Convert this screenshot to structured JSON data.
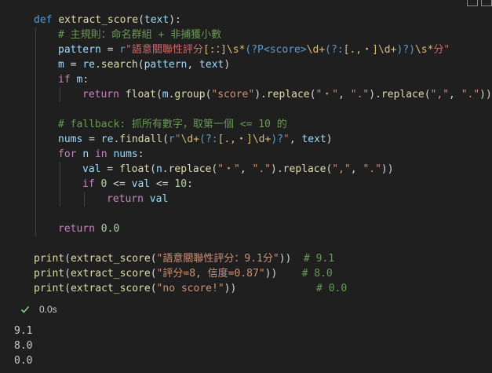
{
  "code": {
    "lines": [
      {
        "tokens": [
          {
            "t": "def",
            "k": "kw"
          },
          {
            "t": " ",
            "k": "op"
          },
          {
            "t": "extract_score",
            "k": "fn"
          },
          {
            "t": "(",
            "k": "op"
          },
          {
            "t": "text",
            "k": "var"
          },
          {
            "t": "):",
            "k": "op"
          }
        ]
      },
      {
        "tokens": [
          {
            "t": "# 主規則：命名群組 + 非捕獲小數",
            "k": "cmt"
          }
        ]
      },
      {
        "tokens": [
          {
            "t": "pattern",
            "k": "var"
          },
          {
            "t": " = ",
            "k": "op"
          },
          {
            "t": "r",
            "k": "kw"
          },
          {
            "t": "\"語意關聯性評分",
            "k": "re"
          },
          {
            "t": "[:：]",
            "k": "rech"
          },
          {
            "t": "\\s",
            "k": "rech"
          },
          {
            "t": "*",
            "k": "rech"
          },
          {
            "t": "(?P<score>",
            "k": "regrp"
          },
          {
            "t": "\\d",
            "k": "rech"
          },
          {
            "t": "+",
            "k": "rech"
          },
          {
            "t": "(?:",
            "k": "regrp"
          },
          {
            "t": "[.,・]",
            "k": "rech"
          },
          {
            "t": "\\d",
            "k": "rech"
          },
          {
            "t": "+",
            "k": "rech"
          },
          {
            "t": ")?",
            "k": "regrp"
          },
          {
            "t": ")",
            "k": "regrp"
          },
          {
            "t": "\\s",
            "k": "rech"
          },
          {
            "t": "*",
            "k": "rech"
          },
          {
            "t": "分\"",
            "k": "re"
          }
        ]
      },
      {
        "tokens": [
          {
            "t": "m",
            "k": "var"
          },
          {
            "t": " = ",
            "k": "op"
          },
          {
            "t": "re",
            "k": "var"
          },
          {
            "t": ".",
            "k": "op"
          },
          {
            "t": "search",
            "k": "fn"
          },
          {
            "t": "(",
            "k": "op"
          },
          {
            "t": "pattern",
            "k": "var"
          },
          {
            "t": ", ",
            "k": "op"
          },
          {
            "t": "text",
            "k": "var"
          },
          {
            "t": ")",
            "k": "op"
          }
        ]
      },
      {
        "tokens": [
          {
            "t": "if",
            "k": "ctl"
          },
          {
            "t": " ",
            "k": "op"
          },
          {
            "t": "m",
            "k": "var"
          },
          {
            "t": ":",
            "k": "op"
          }
        ]
      },
      {
        "tokens": [
          {
            "t": "return",
            "k": "ctl"
          },
          {
            "t": " ",
            "k": "op"
          },
          {
            "t": "float",
            "k": "fn"
          },
          {
            "t": "(",
            "k": "op"
          },
          {
            "t": "m",
            "k": "var"
          },
          {
            "t": ".",
            "k": "op"
          },
          {
            "t": "group",
            "k": "fn"
          },
          {
            "t": "(",
            "k": "op"
          },
          {
            "t": "\"score\"",
            "k": "str"
          },
          {
            "t": ").",
            "k": "op"
          },
          {
            "t": "replace",
            "k": "fn"
          },
          {
            "t": "(",
            "k": "op"
          },
          {
            "t": "\"・\"",
            "k": "str"
          },
          {
            "t": ", ",
            "k": "op"
          },
          {
            "t": "\".\"",
            "k": "str"
          },
          {
            "t": ").",
            "k": "op"
          },
          {
            "t": "replace",
            "k": "fn"
          },
          {
            "t": "(",
            "k": "op"
          },
          {
            "t": "\",\"",
            "k": "str"
          },
          {
            "t": ", ",
            "k": "op"
          },
          {
            "t": "\".\"",
            "k": "str"
          },
          {
            "t": "))",
            "k": "op"
          }
        ]
      },
      {
        "tokens": []
      },
      {
        "tokens": [
          {
            "t": "# fallback: 抓所有數字，取第一個 <= 10 的",
            "k": "cmt"
          }
        ]
      },
      {
        "tokens": [
          {
            "t": "nums",
            "k": "var"
          },
          {
            "t": " = ",
            "k": "op"
          },
          {
            "t": "re",
            "k": "var"
          },
          {
            "t": ".",
            "k": "op"
          },
          {
            "t": "findall",
            "k": "fn"
          },
          {
            "t": "(",
            "k": "op"
          },
          {
            "t": "r",
            "k": "kw"
          },
          {
            "t": "\"",
            "k": "re"
          },
          {
            "t": "\\d",
            "k": "rech"
          },
          {
            "t": "+",
            "k": "rech"
          },
          {
            "t": "(?:",
            "k": "regrp"
          },
          {
            "t": "[.,・]",
            "k": "rech"
          },
          {
            "t": "\\d",
            "k": "rech"
          },
          {
            "t": "+",
            "k": "rech"
          },
          {
            "t": ")?",
            "k": "regrp"
          },
          {
            "t": "\"",
            "k": "re"
          },
          {
            "t": ", ",
            "k": "op"
          },
          {
            "t": "text",
            "k": "var"
          },
          {
            "t": ")",
            "k": "op"
          }
        ]
      },
      {
        "tokens": [
          {
            "t": "for",
            "k": "ctl"
          },
          {
            "t": " ",
            "k": "op"
          },
          {
            "t": "n",
            "k": "var"
          },
          {
            "t": " ",
            "k": "op"
          },
          {
            "t": "in",
            "k": "ctl"
          },
          {
            "t": " ",
            "k": "op"
          },
          {
            "t": "nums",
            "k": "var"
          },
          {
            "t": ":",
            "k": "op"
          }
        ]
      },
      {
        "tokens": [
          {
            "t": "val",
            "k": "var"
          },
          {
            "t": " = ",
            "k": "op"
          },
          {
            "t": "float",
            "k": "fn"
          },
          {
            "t": "(",
            "k": "op"
          },
          {
            "t": "n",
            "k": "var"
          },
          {
            "t": ".",
            "k": "op"
          },
          {
            "t": "replace",
            "k": "fn"
          },
          {
            "t": "(",
            "k": "op"
          },
          {
            "t": "\"・\"",
            "k": "str"
          },
          {
            "t": ", ",
            "k": "op"
          },
          {
            "t": "\".\"",
            "k": "str"
          },
          {
            "t": ").",
            "k": "op"
          },
          {
            "t": "replace",
            "k": "fn"
          },
          {
            "t": "(",
            "k": "op"
          },
          {
            "t": "\",\"",
            "k": "str"
          },
          {
            "t": ", ",
            "k": "op"
          },
          {
            "t": "\".\"",
            "k": "str"
          },
          {
            "t": "))",
            "k": "op"
          }
        ]
      },
      {
        "tokens": [
          {
            "t": "if",
            "k": "ctl"
          },
          {
            "t": " ",
            "k": "op"
          },
          {
            "t": "0",
            "k": "num"
          },
          {
            "t": " <= ",
            "k": "op"
          },
          {
            "t": "val",
            "k": "var"
          },
          {
            "t": " <= ",
            "k": "op"
          },
          {
            "t": "10",
            "k": "num"
          },
          {
            "t": ":",
            "k": "op"
          }
        ]
      },
      {
        "tokens": [
          {
            "t": "return",
            "k": "ctl"
          },
          {
            "t": " ",
            "k": "op"
          },
          {
            "t": "val",
            "k": "var"
          }
        ]
      },
      {
        "tokens": []
      },
      {
        "tokens": [
          {
            "t": "return",
            "k": "ctl"
          },
          {
            "t": " ",
            "k": "op"
          },
          {
            "t": "0.0",
            "k": "num"
          }
        ]
      },
      {
        "tokens": []
      },
      {
        "tokens": [
          {
            "t": "print",
            "k": "fn"
          },
          {
            "t": "(",
            "k": "op"
          },
          {
            "t": "extract_score",
            "k": "fn"
          },
          {
            "t": "(",
            "k": "op"
          },
          {
            "t": "\"語意關聯性評分：9.1分\"",
            "k": "str"
          },
          {
            "t": "))",
            "k": "op"
          },
          {
            "t": "  ",
            "k": "op"
          },
          {
            "t": "# 9.1",
            "k": "cmt"
          }
        ]
      },
      {
        "tokens": [
          {
            "t": "print",
            "k": "fn"
          },
          {
            "t": "(",
            "k": "op"
          },
          {
            "t": "extract_score",
            "k": "fn"
          },
          {
            "t": "(",
            "k": "op"
          },
          {
            "t": "\"評分=8, 信度=0.87\"",
            "k": "str"
          },
          {
            "t": "))",
            "k": "op"
          },
          {
            "t": "    ",
            "k": "op"
          },
          {
            "t": "# 8.0",
            "k": "cmt"
          }
        ]
      },
      {
        "tokens": [
          {
            "t": "print",
            "k": "fn"
          },
          {
            "t": "(",
            "k": "op"
          },
          {
            "t": "extract_score",
            "k": "fn"
          },
          {
            "t": "(",
            "k": "op"
          },
          {
            "t": "\"no score!\"",
            "k": "str"
          },
          {
            "t": "))",
            "k": "op"
          },
          {
            "t": "             ",
            "k": "op"
          },
          {
            "t": "# 0.0",
            "k": "cmt"
          }
        ]
      }
    ]
  },
  "status": {
    "exec_time": "0.0s",
    "success_icon": "check-icon"
  },
  "output": {
    "lines": [
      "9.1",
      "8.0",
      "0.0"
    ]
  },
  "colors": {
    "background": "#1f1f1f",
    "success": "#89d185"
  }
}
